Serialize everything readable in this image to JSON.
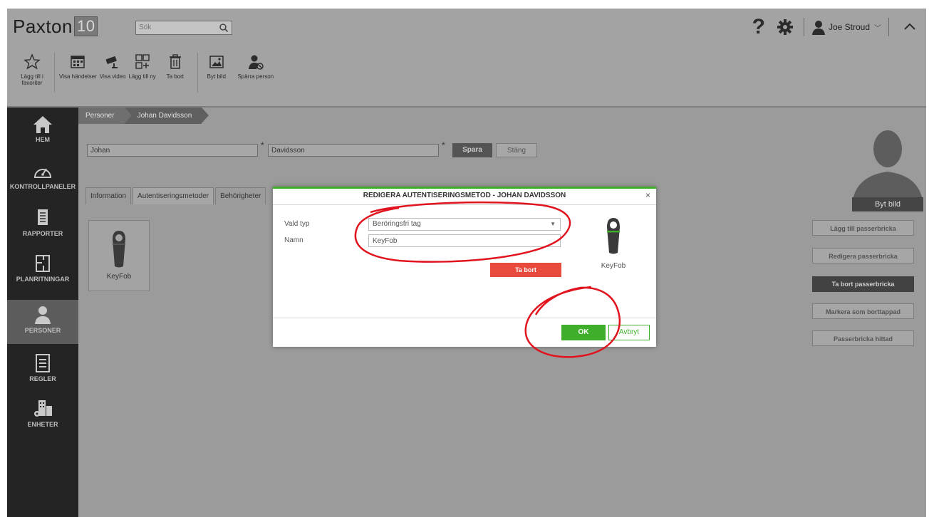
{
  "app": {
    "logo_text": "Paxton",
    "logo_number": "10",
    "search_placeholder": "Sök",
    "help_label": "?",
    "user_name": "Joe Stroud"
  },
  "toolbar": {
    "items": [
      {
        "label": "Lägg till i favoriter",
        "icon": "star-icon"
      },
      {
        "label": "Visa händelser",
        "icon": "calendar-icon"
      },
      {
        "label": "Visa video",
        "icon": "camera-icon"
      },
      {
        "label": "Lägg till ny",
        "icon": "add-grid-icon"
      },
      {
        "label": "Ta bort",
        "icon": "trash-icon"
      },
      {
        "label": "Byt bild",
        "icon": "image-icon"
      },
      {
        "label": "Spärra person",
        "icon": "block-person-icon"
      }
    ]
  },
  "sidebar": {
    "items": [
      {
        "label": "HEM",
        "icon": "home-icon"
      },
      {
        "label": "KONTROLLPANELER",
        "icon": "dashboard-icon"
      },
      {
        "label": "RAPPORTER",
        "icon": "report-icon"
      },
      {
        "label": "PLANRITNINGAR",
        "icon": "floorplan-icon"
      },
      {
        "label": "PERSONER",
        "icon": "person-icon",
        "active": true
      },
      {
        "label": "REGLER",
        "icon": "rules-icon"
      },
      {
        "label": "ENHETER",
        "icon": "devices-icon"
      }
    ]
  },
  "breadcrumb": {
    "items": [
      "Personer",
      "Johan Davidsson"
    ]
  },
  "person": {
    "first_name": "Johan",
    "last_name": "Davidsson",
    "required_mark": "*",
    "save_label": "Spara",
    "close_label": "Stäng",
    "change_picture": "Byt bild"
  },
  "tabs": {
    "items": [
      "Information",
      "Autentiseringsmetoder",
      "Behörigheter"
    ],
    "active_index": 1
  },
  "token_card": {
    "label": "KeyFob"
  },
  "side_actions": {
    "items": [
      {
        "label": "Lägg till passerbricka",
        "style": "light"
      },
      {
        "label": "Redigera passerbricka",
        "style": "light"
      },
      {
        "label": "Ta bort passerbricka",
        "style": "dark"
      },
      {
        "label": "Markera som borttappad",
        "style": "light"
      },
      {
        "label": "Passerbricka hittad",
        "style": "light"
      }
    ]
  },
  "modal": {
    "title": "REDIGERA AUTENTISERINGSMETOD - JOHAN DAVIDSSON",
    "close_label": "×",
    "type_label": "Vald typ",
    "type_value": "Beröringsfri tag",
    "name_label": "Namn",
    "name_value": "KeyFob",
    "delete_label": "Ta bort",
    "preview_label": "KeyFob",
    "ok_label": "OK",
    "cancel_label": "Avbryt"
  },
  "colors": {
    "accent_green": "#3fae2a",
    "danger_red": "#e84a3c",
    "annotation_red": "#e0131e"
  }
}
